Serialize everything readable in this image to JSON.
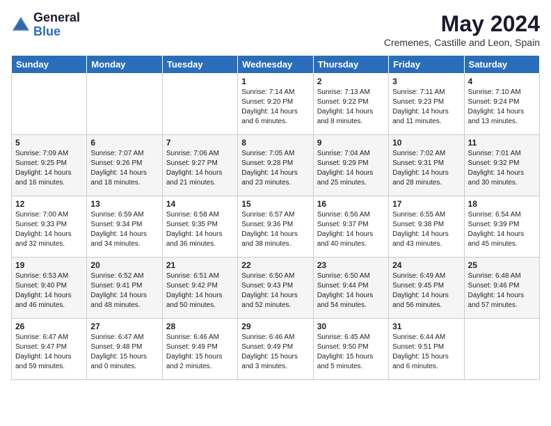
{
  "logo": {
    "general": "General",
    "blue": "Blue"
  },
  "title": "May 2024",
  "location": "Cremenes, Castille and Leon, Spain",
  "weekdays": [
    "Sunday",
    "Monday",
    "Tuesday",
    "Wednesday",
    "Thursday",
    "Friday",
    "Saturday"
  ],
  "weeks": [
    [
      {
        "day": "",
        "info": ""
      },
      {
        "day": "",
        "info": ""
      },
      {
        "day": "",
        "info": ""
      },
      {
        "day": "1",
        "info": "Sunrise: 7:14 AM\nSunset: 9:20 PM\nDaylight: 14 hours\nand 6 minutes."
      },
      {
        "day": "2",
        "info": "Sunrise: 7:13 AM\nSunset: 9:22 PM\nDaylight: 14 hours\nand 8 minutes."
      },
      {
        "day": "3",
        "info": "Sunrise: 7:11 AM\nSunset: 9:23 PM\nDaylight: 14 hours\nand 11 minutes."
      },
      {
        "day": "4",
        "info": "Sunrise: 7:10 AM\nSunset: 9:24 PM\nDaylight: 14 hours\nand 13 minutes."
      }
    ],
    [
      {
        "day": "5",
        "info": "Sunrise: 7:09 AM\nSunset: 9:25 PM\nDaylight: 14 hours\nand 16 minutes."
      },
      {
        "day": "6",
        "info": "Sunrise: 7:07 AM\nSunset: 9:26 PM\nDaylight: 14 hours\nand 18 minutes."
      },
      {
        "day": "7",
        "info": "Sunrise: 7:06 AM\nSunset: 9:27 PM\nDaylight: 14 hours\nand 21 minutes."
      },
      {
        "day": "8",
        "info": "Sunrise: 7:05 AM\nSunset: 9:28 PM\nDaylight: 14 hours\nand 23 minutes."
      },
      {
        "day": "9",
        "info": "Sunrise: 7:04 AM\nSunset: 9:29 PM\nDaylight: 14 hours\nand 25 minutes."
      },
      {
        "day": "10",
        "info": "Sunrise: 7:02 AM\nSunset: 9:31 PM\nDaylight: 14 hours\nand 28 minutes."
      },
      {
        "day": "11",
        "info": "Sunrise: 7:01 AM\nSunset: 9:32 PM\nDaylight: 14 hours\nand 30 minutes."
      }
    ],
    [
      {
        "day": "12",
        "info": "Sunrise: 7:00 AM\nSunset: 9:33 PM\nDaylight: 14 hours\nand 32 minutes."
      },
      {
        "day": "13",
        "info": "Sunrise: 6:59 AM\nSunset: 9:34 PM\nDaylight: 14 hours\nand 34 minutes."
      },
      {
        "day": "14",
        "info": "Sunrise: 6:58 AM\nSunset: 9:35 PM\nDaylight: 14 hours\nand 36 minutes."
      },
      {
        "day": "15",
        "info": "Sunrise: 6:57 AM\nSunset: 9:36 PM\nDaylight: 14 hours\nand 38 minutes."
      },
      {
        "day": "16",
        "info": "Sunrise: 6:56 AM\nSunset: 9:37 PM\nDaylight: 14 hours\nand 40 minutes."
      },
      {
        "day": "17",
        "info": "Sunrise: 6:55 AM\nSunset: 9:38 PM\nDaylight: 14 hours\nand 43 minutes."
      },
      {
        "day": "18",
        "info": "Sunrise: 6:54 AM\nSunset: 9:39 PM\nDaylight: 14 hours\nand 45 minutes."
      }
    ],
    [
      {
        "day": "19",
        "info": "Sunrise: 6:53 AM\nSunset: 9:40 PM\nDaylight: 14 hours\nand 46 minutes."
      },
      {
        "day": "20",
        "info": "Sunrise: 6:52 AM\nSunset: 9:41 PM\nDaylight: 14 hours\nand 48 minutes."
      },
      {
        "day": "21",
        "info": "Sunrise: 6:51 AM\nSunset: 9:42 PM\nDaylight: 14 hours\nand 50 minutes."
      },
      {
        "day": "22",
        "info": "Sunrise: 6:50 AM\nSunset: 9:43 PM\nDaylight: 14 hours\nand 52 minutes."
      },
      {
        "day": "23",
        "info": "Sunrise: 6:50 AM\nSunset: 9:44 PM\nDaylight: 14 hours\nand 54 minutes."
      },
      {
        "day": "24",
        "info": "Sunrise: 6:49 AM\nSunset: 9:45 PM\nDaylight: 14 hours\nand 56 minutes."
      },
      {
        "day": "25",
        "info": "Sunrise: 6:48 AM\nSunset: 9:46 PM\nDaylight: 14 hours\nand 57 minutes."
      }
    ],
    [
      {
        "day": "26",
        "info": "Sunrise: 6:47 AM\nSunset: 9:47 PM\nDaylight: 14 hours\nand 59 minutes."
      },
      {
        "day": "27",
        "info": "Sunrise: 6:47 AM\nSunset: 9:48 PM\nDaylight: 15 hours\nand 0 minutes."
      },
      {
        "day": "28",
        "info": "Sunrise: 6:46 AM\nSunset: 9:49 PM\nDaylight: 15 hours\nand 2 minutes."
      },
      {
        "day": "29",
        "info": "Sunrise: 6:46 AM\nSunset: 9:49 PM\nDaylight: 15 hours\nand 3 minutes."
      },
      {
        "day": "30",
        "info": "Sunrise: 6:45 AM\nSunset: 9:50 PM\nDaylight: 15 hours\nand 5 minutes."
      },
      {
        "day": "31",
        "info": "Sunrise: 6:44 AM\nSunset: 9:51 PM\nDaylight: 15 hours\nand 6 minutes."
      },
      {
        "day": "",
        "info": ""
      }
    ]
  ]
}
